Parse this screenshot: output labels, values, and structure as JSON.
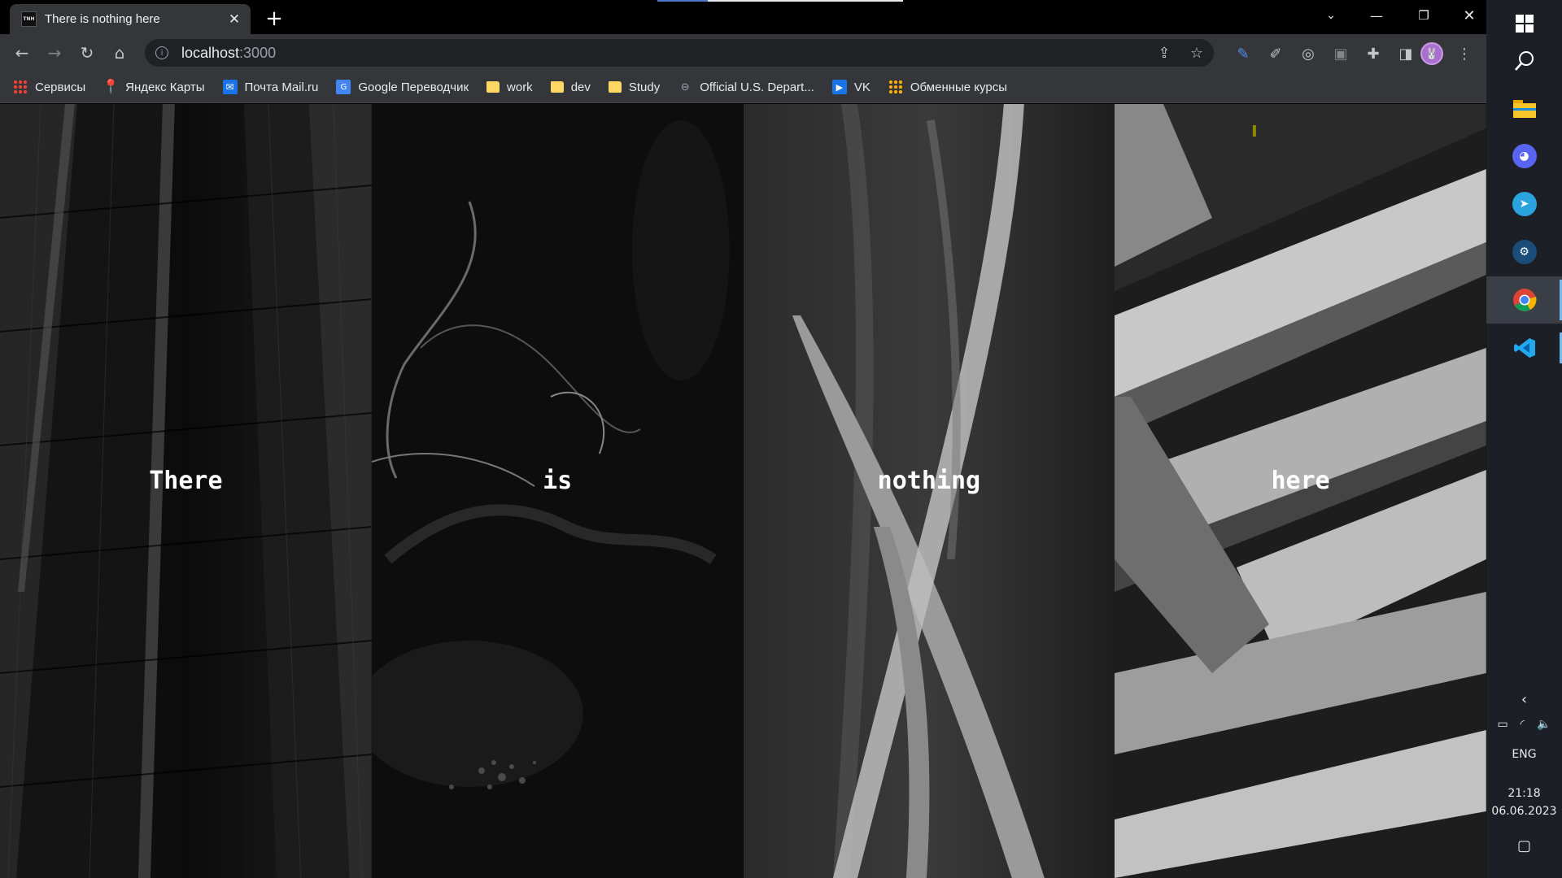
{
  "browser": {
    "tab": {
      "title": "There is nothing here",
      "favicon_text": "TNH"
    },
    "address": {
      "host": "localhost",
      "port": ":3000"
    },
    "bookmarks": [
      {
        "label": "Сервисы",
        "icon": "apps-grid-icon"
      },
      {
        "label": "Яндекс Карты",
        "icon": "map-pin-icon"
      },
      {
        "label": "Почта Mail.ru",
        "icon": "mail-icon"
      },
      {
        "label": "Google Переводчик",
        "icon": "translate-icon"
      },
      {
        "label": "work",
        "icon": "folder-icon"
      },
      {
        "label": "dev",
        "icon": "folder-icon"
      },
      {
        "label": "Study",
        "icon": "folder-icon"
      },
      {
        "label": "Official U.S. Depart...",
        "icon": "link-icon"
      },
      {
        "label": "VK",
        "icon": "vk-icon"
      },
      {
        "label": "Обменные курсы",
        "icon": "dots-grid-icon"
      }
    ]
  },
  "page": {
    "words": [
      "There",
      "is",
      "nothing",
      "here"
    ],
    "panels": [
      "skyscraper-photo",
      "dark-marble-photo",
      "grass-blades-photo",
      "balconies-photo"
    ]
  },
  "taskbar": {
    "apps": [
      "windows-start-icon",
      "search-icon",
      "file-explorer-icon",
      "discord-icon",
      "telegram-icon",
      "steam-icon",
      "chrome-icon",
      "vscode-icon"
    ],
    "language": "ENG",
    "time": "21:18",
    "date": "06.06.2023"
  },
  "colors": {
    "tab_bg": "#35363a",
    "omnibox_bg": "#202124",
    "taskbar_bg": "#1c2026",
    "accent": "#76b9ed"
  }
}
